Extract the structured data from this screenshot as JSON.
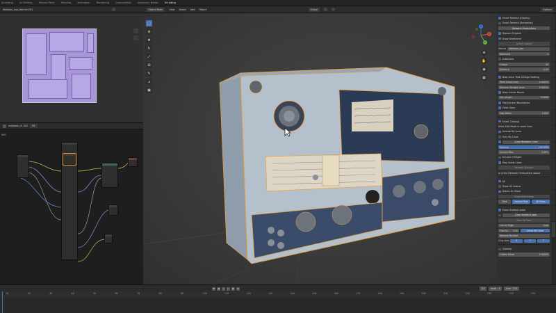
{
  "workspaces": [
    "Sculpting",
    "UV Editing",
    "Texture Paint",
    "Shading",
    "Animation",
    "Rendering",
    "Compositing",
    "Geometry Nodes",
    "Scripting"
  ],
  "uv_editor": {
    "image_name": "Walkbox_low_Normal.001"
  },
  "node_editor": {
    "material_name": "radiobox_v1.002",
    "user_count": "94",
    "side_label": "009"
  },
  "viewport": {
    "mode": "Object Mode",
    "menus": [
      "View",
      "Select",
      "Add",
      "Object"
    ],
    "transform": "Global",
    "gizmo_axes": {
      "x": "X",
      "y": "Y",
      "z": "Z"
    }
  },
  "right_panel": {
    "options": "Options",
    "smart_remesh": "Smart Remesh (Display)",
    "smart_remesh_2": "Smart Remesh (Remesher)",
    "network_header": "Network Hardsurface",
    "replace_original": "Replace Original",
    "show_wireframe": "Show Wireframe",
    "select_closest": "Select Closest",
    "source_label": "Source",
    "source_value": "Walkbox_low",
    "balanced": "Balanced",
    "automatic": "Automatic",
    "crease_label": "Crease",
    "crease_value": "40",
    "distance_label": "Distance",
    "distance_value": "2.00",
    "drop_lines": "Drop Lines That Change Nothing",
    "weld_close_lines": "Weld Close Lines",
    "weld_close_value": "0.00010",
    "remove_straight_lines": "Remove Straight Lines",
    "remove_straight_value": "0.00010",
    "keep_circles": "Keep Circles Round",
    "min_length": "Min Length",
    "min_length_value": "3.0000",
    "flatten_contours": "Flat/Convert Boundaries",
    "close_gaps": "Close Gaps",
    "gap_match": "Gap Match",
    "gap_match_value": "0.000",
    "smart_cleanup": "Smart Cleanup",
    "enter_edit": "Enter Edit Mode to mark lines",
    "include_my_lines": "Include My Lines",
    "only_my_lines": "Only My Lines",
    "clean_between_lines": "Clean Between Lines",
    "reverse_label": "Reverse",
    "reverse_value": "100.00%",
    "second_pass": "Second Pass",
    "second_pass_value": "0.00%",
    "at_least": "At Least 3 Edges",
    "stay_inside": "Stay Inside Lines",
    "remesh_sharpen": "Remesh Sharpen",
    "press_network": "or press Network Hardsurface above",
    "uv_section": "UV",
    "show_uv_seams": "Show UV Seams",
    "seams_as_sharp": "Seams As Sharp",
    "seam_from_sharp": "Seam From Sharp",
    "grid_label": "Grid",
    "normal_map": "Normal Map",
    "all_maps": "All Maps",
    "erase_useless": "Erase Useless Loops",
    "drop_useless": "Drop Useless Loops",
    "back_to_start": "Back To Start",
    "cancel_edge_label": "Cancel Edge",
    "cancel_edge_value": "Auto",
    "flat_mult_label": "Flat Mu...",
    "flat_mult_value": "0.00",
    "sticky_loops": "Sharp My Lines",
    "remove_re_sept": "Remove Re-Sept",
    "only_axis": "Only Axis",
    "axis_x": "X",
    "axis_y": "Y",
    "axis_z": "Z",
    "chamfer": "Chamfer",
    "flatten_bevel_label": "Flatten Bevel",
    "flatten_bevel_value": "0.00000"
  },
  "timeline": {
    "current_frame": "24",
    "start_label": "Start",
    "start_value": "1",
    "end_label": "End",
    "end_value": "250",
    "ruler": [
      "10",
      "20",
      "30",
      "40",
      "50",
      "60",
      "70",
      "80",
      "90",
      "100",
      "110",
      "120",
      "130",
      "140",
      "150",
      "160",
      "170",
      "180",
      "190",
      "200",
      "210",
      "220",
      "230",
      "240",
      "250"
    ]
  },
  "colors": {
    "accent": "#4772b3",
    "selection_outline": "#e0902f",
    "uv_background": "#a895d8",
    "panel": "#303030"
  }
}
